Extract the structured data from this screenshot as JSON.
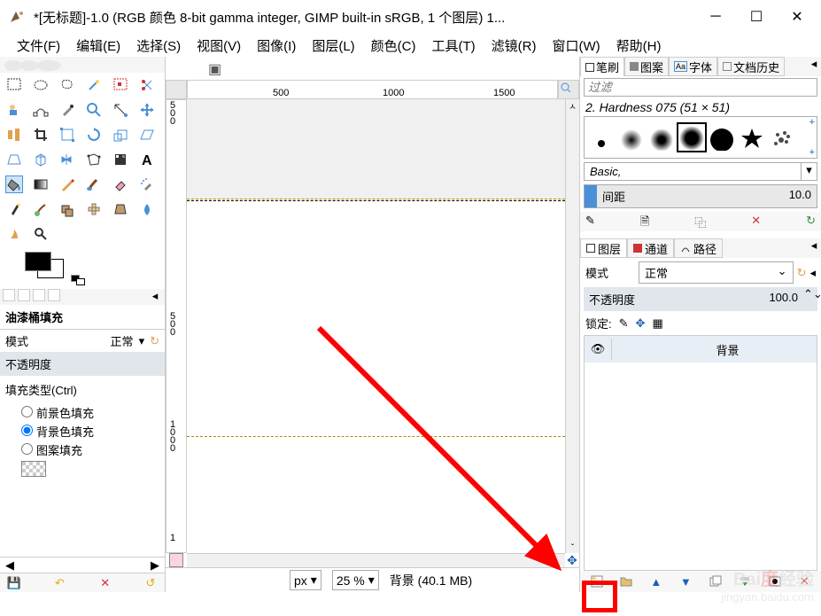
{
  "window": {
    "title": "*[无标题]-1.0 (RGB 颜色 8-bit gamma integer, GIMP built-in sRGB, 1 个图层) 1..."
  },
  "menu": {
    "file": "文件(F)",
    "edit": "编辑(E)",
    "select": "选择(S)",
    "view": "视图(V)",
    "image": "图像(I)",
    "layer": "图层(L)",
    "color": "颜色(C)",
    "tools": "工具(T)",
    "filters": "滤镜(R)",
    "windows": "窗口(W)",
    "help": "帮助(H)"
  },
  "ruler_h": {
    "m500": "500",
    "m1000": "1000",
    "m1500": "1500"
  },
  "ruler_v": {
    "m0a": "5",
    "m0b": "0",
    "m0c": "0",
    "m5a": "5",
    "m5b": "0",
    "m5c": "0",
    "m10a": "1",
    "m10b": "0",
    "m10c": "0",
    "m10d": "0",
    "m15a": "1"
  },
  "tooloptions": {
    "title": "油漆桶填充",
    "mode": "模式",
    "mode_val": "正常",
    "opacity": "不透明度",
    "filltype": "填充类型(Ctrl)",
    "fg": "前景色填充",
    "bg": "背景色填充",
    "pat": "图案填充"
  },
  "status": {
    "px": "px",
    "zoom": "25 %",
    "layer": "背景 (40.1 MB)"
  },
  "brushpanel": {
    "brush_tab": "笔刷",
    "pattern_tab": "图案",
    "font_tab": "字体",
    "hist_tab": "文档历史",
    "filter": "过滤",
    "brushname": "2. Hardness 075 (51 × 51)",
    "group": "Basic,",
    "spacing_lab": "间距",
    "spacing_val": "10.0"
  },
  "layerspanel": {
    "layers_tab": "图层",
    "channels_tab": "通道",
    "paths_tab": "路径",
    "mode": "模式",
    "mode_val": "正常",
    "opacity": "不透明度",
    "opacity_val": "100.0",
    "lock": "锁定:",
    "layer_bg": "背景"
  },
  "watermark": {
    "l1": "Baidu 经验",
    "l2": "jingyan.baidu.com"
  }
}
